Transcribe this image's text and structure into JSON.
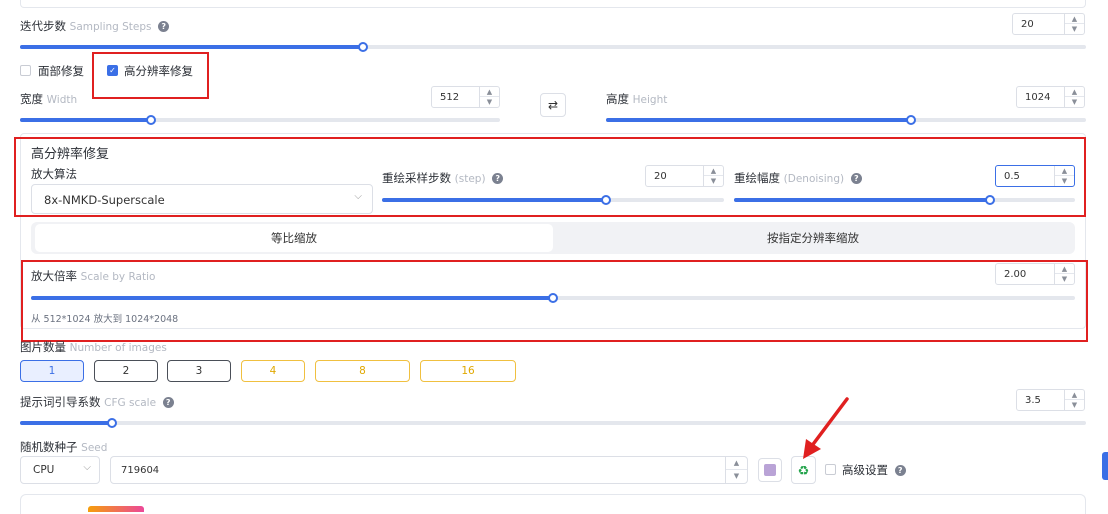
{
  "steps": {
    "label": "迭代步数",
    "sub": "Sampling Steps",
    "value": "20",
    "ratio": 0.343
  },
  "checks": {
    "face": "面部修复",
    "hires": "高分辨率修复"
  },
  "width": {
    "label": "宽度",
    "sub": "Width",
    "value": "512",
    "ratio": 0.272
  },
  "height": {
    "label": "高度",
    "sub": "Height",
    "value": "1024",
    "ratio": 0.63
  },
  "hires": {
    "title": "高分辨率修复",
    "upscaler_label": "放大算法",
    "upscaler_value": "8x-NMKD-Superscale",
    "hr_steps_label": "重绘采样步数",
    "hr_steps_sub": "(step)",
    "hr_steps_value": "20",
    "hr_steps_ratio": 0.65,
    "denoise_label": "重绘幅度",
    "denoise_sub": "(Denoising)",
    "denoise_value": "0.5",
    "denoise_ratio": 0.75,
    "tab1": "等比缩放",
    "tab2": "按指定分辨率缩放",
    "scale_label": "放大倍率",
    "scale_sub": "Scale by Ratio",
    "scale_value": "2.00",
    "scale_ratio": 0.497,
    "scale_note": "从 512*1024 放大到 1024*2048"
  },
  "count": {
    "label": "图片数量",
    "sub": "Number of images",
    "options": [
      "1",
      "2",
      "3",
      "4",
      "8",
      "16"
    ]
  },
  "cfg": {
    "label": "提示词引导系数",
    "sub": "CFG scale",
    "value": "3.5",
    "ratio": 0.086
  },
  "seed": {
    "label": "随机数种子",
    "sub": "Seed",
    "device": "CPU",
    "value": "719604",
    "advanced": "高级设置"
  },
  "colors": {
    "accent": "#3b6fe6",
    "highlight": "#e02020",
    "gold": "#f0c040"
  }
}
